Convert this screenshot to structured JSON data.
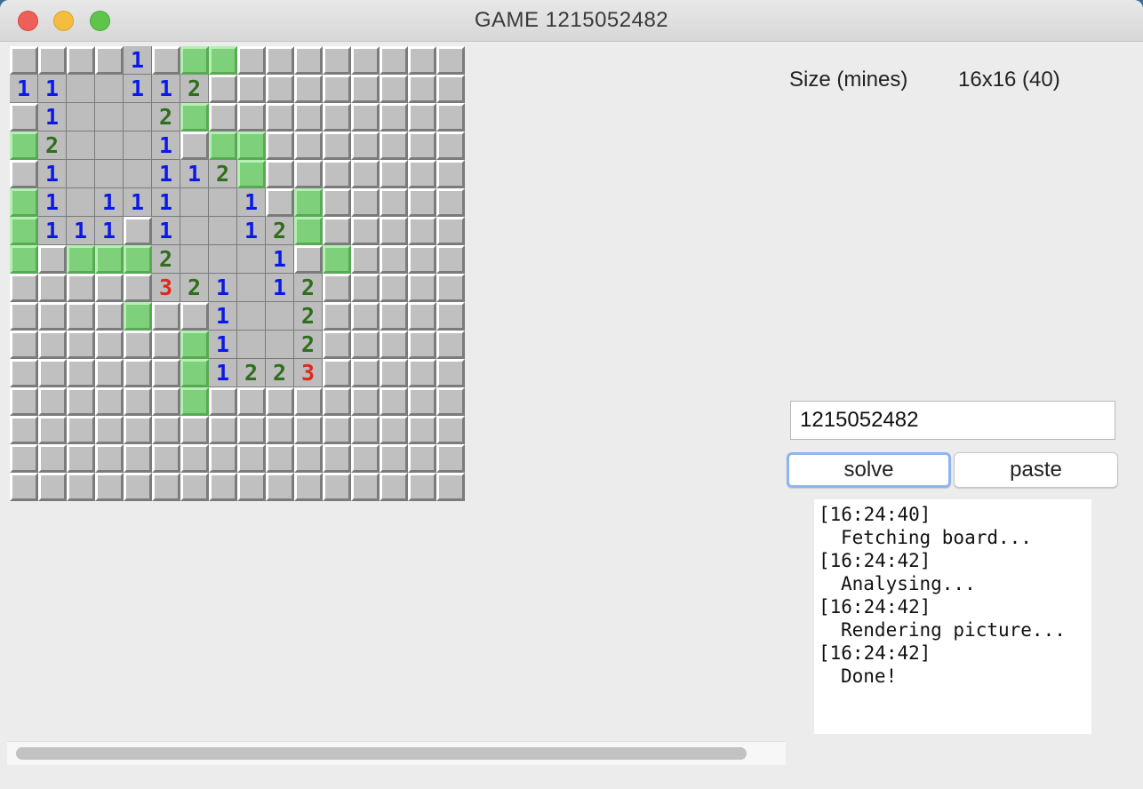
{
  "window": {
    "title": "GAME 1215052482",
    "controls": [
      "close",
      "minimize",
      "maximize"
    ]
  },
  "colors": {
    "flag": "#7ed07a",
    "closed": "#c0c0c0",
    "open": "#bdbdbd",
    "number_1": "#0a19e8",
    "number_2": "#2e6e1c",
    "number_3": "#e0281c",
    "solve_focus": "#8db5ef"
  },
  "board": {
    "size": 16,
    "legend": {
      "#": "closed",
      "F": "flag",
      ".": "open empty",
      "1-3": "open number"
    },
    "rows": [
      "####1#FF########",
      "11..112#########",
      "#1...2F#########",
      "F2...1#FF#######",
      "#1...112F#######",
      "F1.111..1#F#####",
      "F111#1..12F#####",
      "F#FFF2...1#F####",
      "#####321.12#####",
      "####F##1..2#####",
      "######F1..2#####",
      "######F1223#####",
      "######F#########",
      "################",
      "################",
      "################"
    ]
  },
  "info": {
    "label": "Size (mines)",
    "value": "16x16 (40)"
  },
  "game_input": {
    "value": "1215052482"
  },
  "buttons": {
    "solve": "solve",
    "paste": "paste"
  },
  "log": [
    {
      "time": "[16:24:40]",
      "message": "Fetching board..."
    },
    {
      "time": "[16:24:42]",
      "message": "Analysing..."
    },
    {
      "time": "[16:24:42]",
      "message": "Rendering picture..."
    },
    {
      "time": "[16:24:42]",
      "message": "Done!"
    }
  ]
}
